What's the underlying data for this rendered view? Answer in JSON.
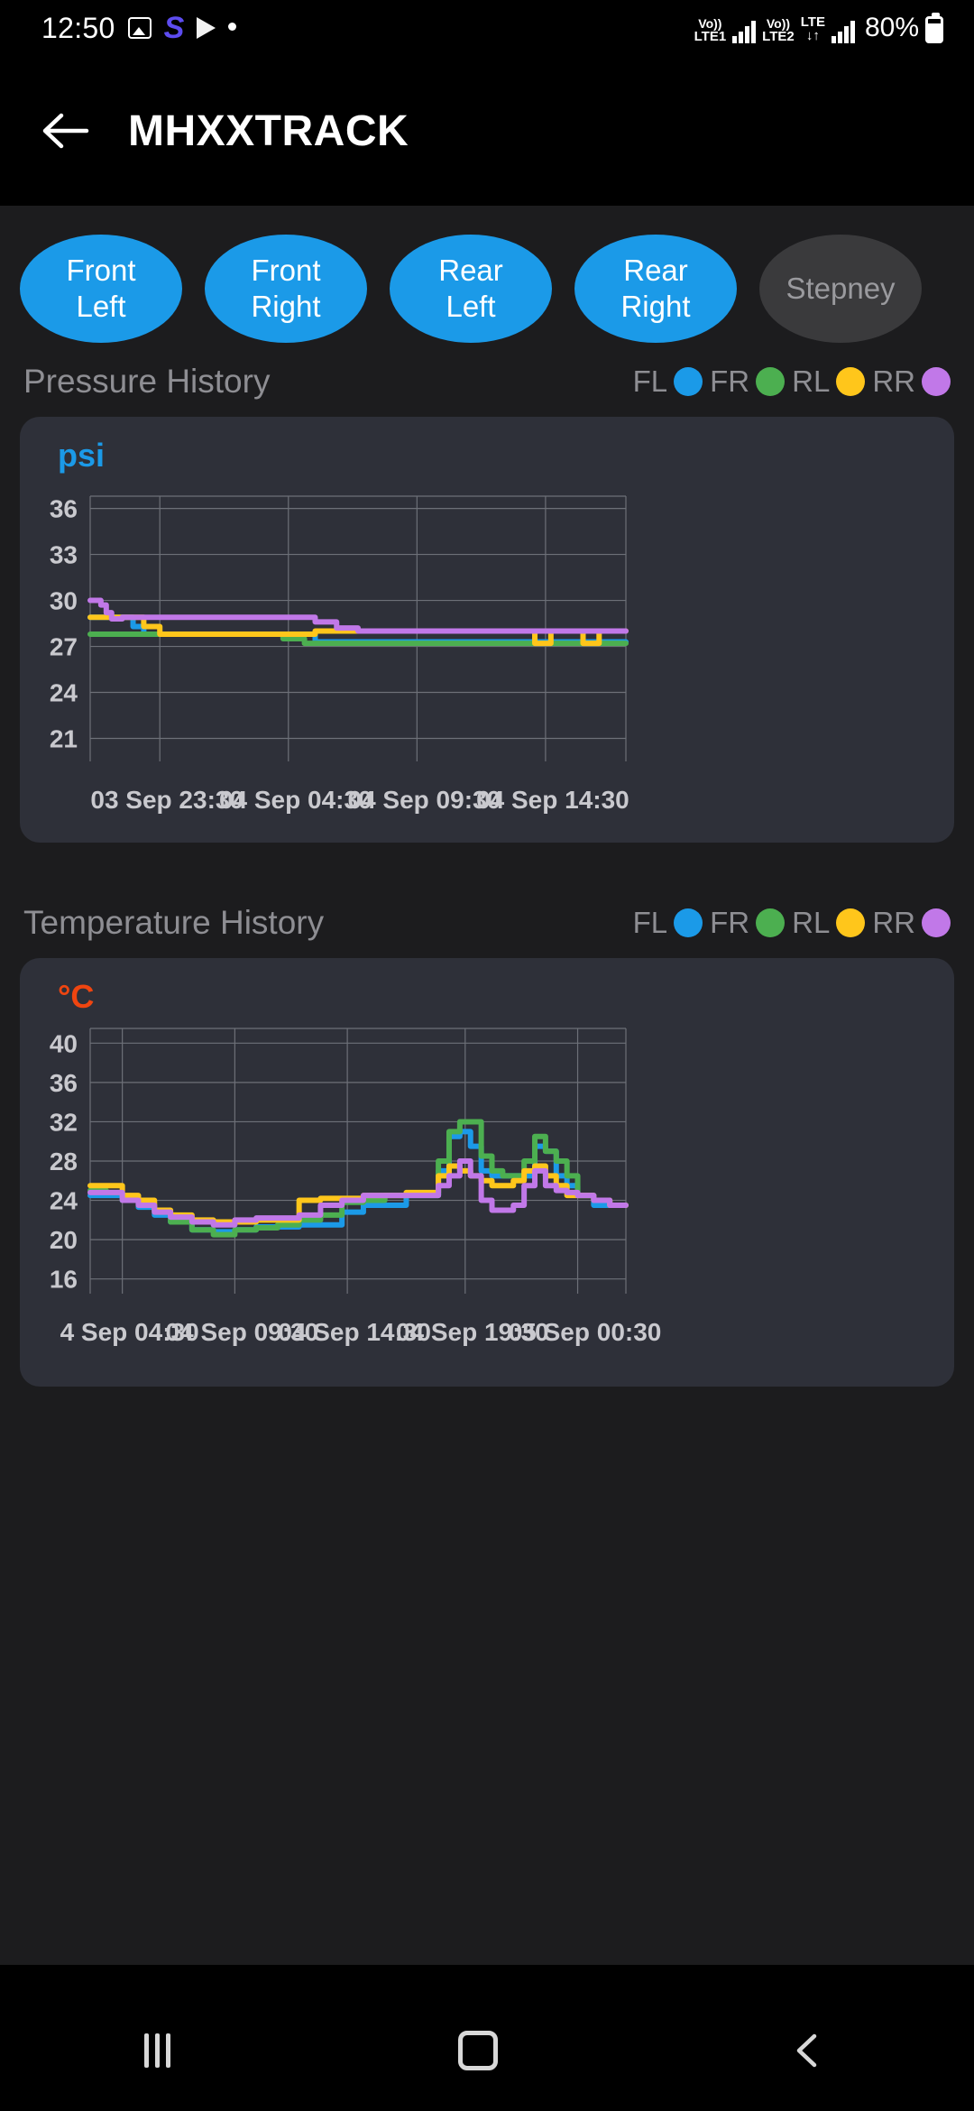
{
  "status_bar": {
    "time": "12:50",
    "icons": [
      "image-icon",
      "samsung-s-icon",
      "play-icon",
      "dot-icon"
    ],
    "s_glyph": "S",
    "network": [
      {
        "label_top": "Vo))",
        "label_bottom": "LTE1"
      },
      {
        "label_top": "Vo))",
        "label_bottom": "LTE2"
      },
      {
        "label_top": "LTE",
        "label_bottom": "↓↑"
      }
    ],
    "battery_percent": "80%"
  },
  "appbar": {
    "back_icon": "arrow-left-icon",
    "title": "MHXXTRACK"
  },
  "wheel_chips": [
    {
      "line1": "Front",
      "line2": "Left",
      "active": true
    },
    {
      "line1": "Front",
      "line2": "Right",
      "active": true
    },
    {
      "line1": "Rear",
      "line2": "Left",
      "active": true
    },
    {
      "line1": "Rear",
      "line2": "Right",
      "active": true
    },
    {
      "line1": "Stepney",
      "line2": "",
      "active": false
    }
  ],
  "legend": [
    {
      "label": "FL",
      "color": "#1b9ae8"
    },
    {
      "label": "FR",
      "color": "#4caf50"
    },
    {
      "label": "RL",
      "color": "#ffc61b"
    },
    {
      "label": "RR",
      "color": "#c178e8"
    }
  ],
  "sections": {
    "pressure_title": "Pressure History",
    "temperature_title": "Temperature History"
  },
  "chart_data": [
    {
      "type": "line",
      "title": "Pressure History",
      "unit_label": "psi",
      "ylabel": "psi",
      "xlabel": "",
      "ylim": [
        19.5,
        36.8
      ],
      "yticks": [
        36,
        33,
        30,
        27,
        24,
        21
      ],
      "grid": true,
      "legend_position": "top-right",
      "xticks": [
        "03 Sep 23:30",
        "04 Sep 04:30",
        "04 Sep 09:30",
        "04 Sep 14:30"
      ],
      "xtick_positions": [
        0.13,
        0.37,
        0.61,
        0.85
      ],
      "x": [
        0,
        0.01,
        0.02,
        0.03,
        0.04,
        0.06,
        0.08,
        0.1,
        0.13,
        0.18,
        0.25,
        0.3,
        0.36,
        0.4,
        0.42,
        0.46,
        0.5,
        0.55,
        0.6,
        0.64,
        0.68,
        0.72,
        0.76,
        0.8,
        0.83,
        0.86,
        0.89,
        0.92,
        0.95,
        0.98,
        1.0
      ],
      "series": [
        {
          "name": "FL",
          "color": "#1b9ae8",
          "values": [
            28.9,
            28.9,
            28.9,
            28.9,
            28.9,
            28.9,
            28.3,
            27.8,
            27.8,
            27.8,
            27.8,
            27.8,
            27.8,
            27.8,
            27.3,
            27.3,
            27.3,
            27.3,
            27.3,
            27.3,
            27.3,
            27.3,
            27.3,
            27.3,
            27.3,
            27.3,
            27.3,
            27.3,
            27.3,
            27.3,
            27.3
          ]
        },
        {
          "name": "FR",
          "color": "#4caf50",
          "values": [
            27.8,
            27.8,
            27.8,
            27.8,
            27.8,
            27.8,
            27.8,
            27.8,
            27.8,
            27.8,
            27.8,
            27.8,
            27.5,
            27.2,
            27.2,
            27.2,
            27.2,
            27.2,
            27.2,
            27.2,
            27.2,
            27.2,
            27.2,
            27.2,
            27.2,
            27.2,
            27.2,
            27.2,
            27.2,
            27.2,
            27.2
          ]
        },
        {
          "name": "RL",
          "color": "#ffc61b",
          "values": [
            28.9,
            28.9,
            28.9,
            28.9,
            28.9,
            28.9,
            28.9,
            28.3,
            27.8,
            27.8,
            27.8,
            27.8,
            27.8,
            27.8,
            28.0,
            28.0,
            28.0,
            28.0,
            28.0,
            28.0,
            28.0,
            28.0,
            28.0,
            28.0,
            27.2,
            28.0,
            28.0,
            27.2,
            28.0,
            28.0,
            28.0
          ]
        },
        {
          "name": "RR",
          "color": "#c178e8",
          "values": [
            30.0,
            30.0,
            29.7,
            29.2,
            28.8,
            28.9,
            28.9,
            28.9,
            28.9,
            28.9,
            28.9,
            28.9,
            28.9,
            28.9,
            28.6,
            28.2,
            28.0,
            28.0,
            28.0,
            28.0,
            28.0,
            28.0,
            28.0,
            28.0,
            28.0,
            28.0,
            28.0,
            28.0,
            28.0,
            28.0,
            28.0
          ]
        }
      ]
    },
    {
      "type": "line",
      "title": "Temperature History",
      "unit_label": "°C",
      "ylabel": "°C",
      "xlabel": "",
      "ylim": [
        14.5,
        41.5
      ],
      "yticks": [
        40,
        36,
        32,
        28,
        24,
        20,
        16
      ],
      "grid": true,
      "legend_position": "top-right",
      "xticks": [
        "4 Sep 04:30",
        "04 Sep 09:30",
        "04 Sep 14:30",
        "04 Sep 19:30",
        "05 Sep 00:30"
      ],
      "xtick_positions": [
        0.06,
        0.27,
        0.48,
        0.7,
        0.91
      ],
      "x": [
        0,
        0.03,
        0.06,
        0.09,
        0.12,
        0.15,
        0.19,
        0.23,
        0.27,
        0.31,
        0.35,
        0.39,
        0.43,
        0.47,
        0.51,
        0.55,
        0.59,
        0.62,
        0.65,
        0.67,
        0.69,
        0.71,
        0.73,
        0.75,
        0.77,
        0.79,
        0.81,
        0.83,
        0.85,
        0.87,
        0.89,
        0.91,
        0.94,
        0.97,
        1.0
      ],
      "series": [
        {
          "name": "FL",
          "color": "#1b9ae8",
          "values": [
            24.5,
            24.5,
            24.0,
            23.3,
            22.5,
            21.8,
            21.0,
            20.8,
            21.0,
            21.3,
            21.3,
            21.5,
            21.5,
            22.8,
            23.5,
            23.5,
            24.5,
            24.5,
            27.0,
            30.5,
            31.0,
            29.5,
            27.0,
            26.5,
            26.5,
            26.5,
            26.5,
            29.5,
            29.0,
            26.5,
            25.5,
            24.5,
            23.5,
            23.5,
            23.5
          ]
        },
        {
          "name": "FR",
          "color": "#4caf50",
          "values": [
            25.0,
            24.8,
            24.0,
            23.5,
            22.8,
            21.8,
            21.0,
            20.5,
            21.0,
            21.2,
            21.5,
            22.0,
            22.5,
            23.8,
            24.0,
            24.5,
            24.5,
            24.5,
            28.0,
            31.0,
            32.0,
            32.0,
            28.5,
            27.0,
            26.5,
            26.5,
            28.0,
            30.5,
            29.0,
            28.0,
            26.5,
            24.5,
            24.0,
            23.5,
            23.5
          ]
        },
        {
          "name": "RL",
          "color": "#ffc61b",
          "values": [
            25.5,
            25.5,
            24.5,
            24.0,
            23.0,
            22.5,
            22.0,
            21.8,
            21.8,
            22.0,
            22.0,
            24.0,
            24.2,
            24.2,
            24.5,
            24.5,
            24.8,
            24.8,
            26.5,
            27.5,
            27.0,
            26.5,
            26.0,
            25.5,
            25.5,
            26.0,
            27.0,
            27.5,
            26.5,
            25.5,
            24.5,
            24.5,
            24.0,
            23.5,
            23.5
          ]
        },
        {
          "name": "RR",
          "color": "#c178e8",
          "values": [
            24.8,
            24.8,
            24.0,
            23.5,
            22.8,
            22.3,
            21.8,
            21.5,
            22.0,
            22.2,
            22.2,
            22.5,
            23.5,
            24.0,
            24.5,
            24.5,
            24.5,
            24.5,
            25.5,
            26.5,
            28.0,
            26.5,
            24.0,
            23.0,
            23.0,
            23.5,
            25.5,
            27.0,
            25.5,
            25.0,
            24.8,
            24.5,
            24.0,
            23.5,
            23.5
          ]
        }
      ]
    }
  ],
  "navbar": {
    "recent_label": "recent-apps",
    "home_label": "home",
    "back_label": "back"
  }
}
